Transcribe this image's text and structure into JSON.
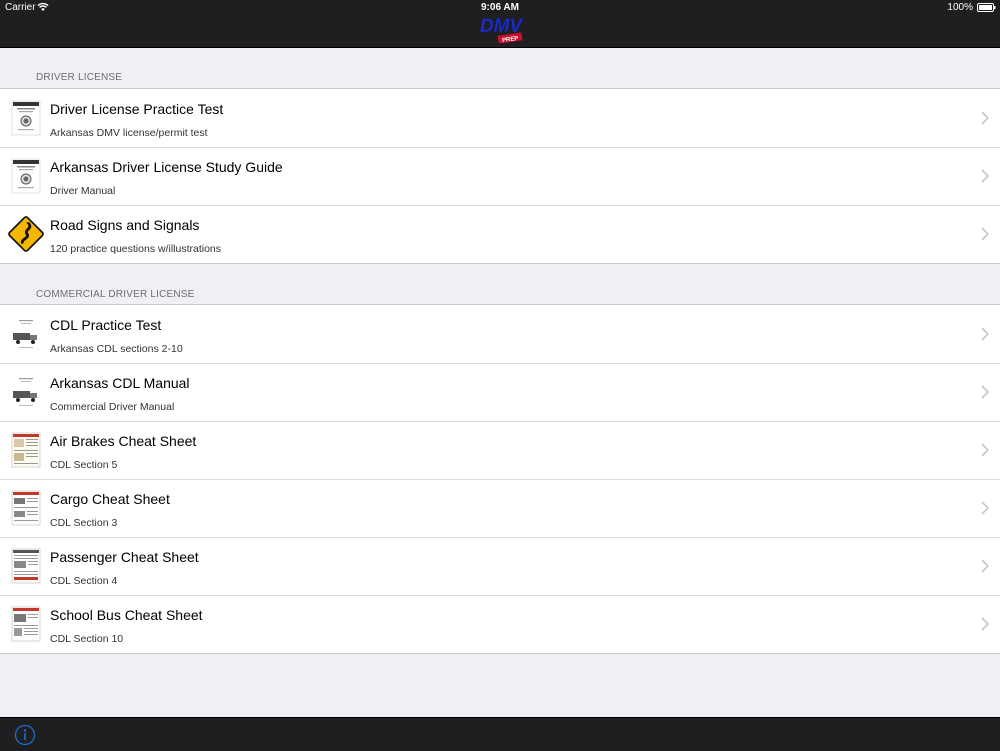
{
  "status_bar": {
    "carrier": "Carrier",
    "time": "9:06 AM",
    "battery_percent": "100%",
    "icons": [
      "wifi-icon",
      "battery-icon"
    ]
  },
  "nav_bar": {
    "logo_text": "DMV",
    "logo_badge": "PREP",
    "logo_colors": {
      "text": "#1d2fbf",
      "badge": "#c8102e"
    }
  },
  "sections": [
    {
      "header": "DRIVER LICENSE",
      "items": [
        {
          "title": "Driver License Practice Test",
          "subtitle": "Arkansas DMV license/permit test",
          "icon": "manual-cover-icon"
        },
        {
          "title": "Arkansas Driver License Study Guide",
          "subtitle": "Driver Manual",
          "icon": "manual-cover-icon"
        },
        {
          "title": "Road Signs and Signals",
          "subtitle": "120 practice questions w/illustrations",
          "icon": "winding-road-sign-icon"
        }
      ]
    },
    {
      "header": "COMMERCIAL DRIVER LICENSE",
      "items": [
        {
          "title": "CDL Practice Test",
          "subtitle": "Arkansas CDL sections 2-10",
          "icon": "cdl-manual-cover-icon"
        },
        {
          "title": "Arkansas CDL Manual",
          "subtitle": "Commercial Driver Manual",
          "icon": "cdl-manual-cover-icon"
        },
        {
          "title": "Air Brakes Cheat Sheet",
          "subtitle": "CDL Section 5",
          "icon": "cheat-sheet-icon"
        },
        {
          "title": "Cargo Cheat Sheet",
          "subtitle": "CDL Section 3",
          "icon": "cheat-sheet-icon"
        },
        {
          "title": "Passenger Cheat Sheet",
          "subtitle": "CDL Section 4",
          "icon": "cheat-sheet-icon"
        },
        {
          "title": "School Bus Cheat Sheet",
          "subtitle": "CDL Section 10",
          "icon": "cheat-sheet-icon"
        }
      ]
    }
  ],
  "tab_bar": {
    "info_icon": "info-icon",
    "accent": "#1a6fd6"
  },
  "colors": {
    "bar_background": "#1f1f21",
    "page_background": "#efeff4",
    "header_text": "#6d6d72",
    "chevron": "#c7c7cc"
  }
}
